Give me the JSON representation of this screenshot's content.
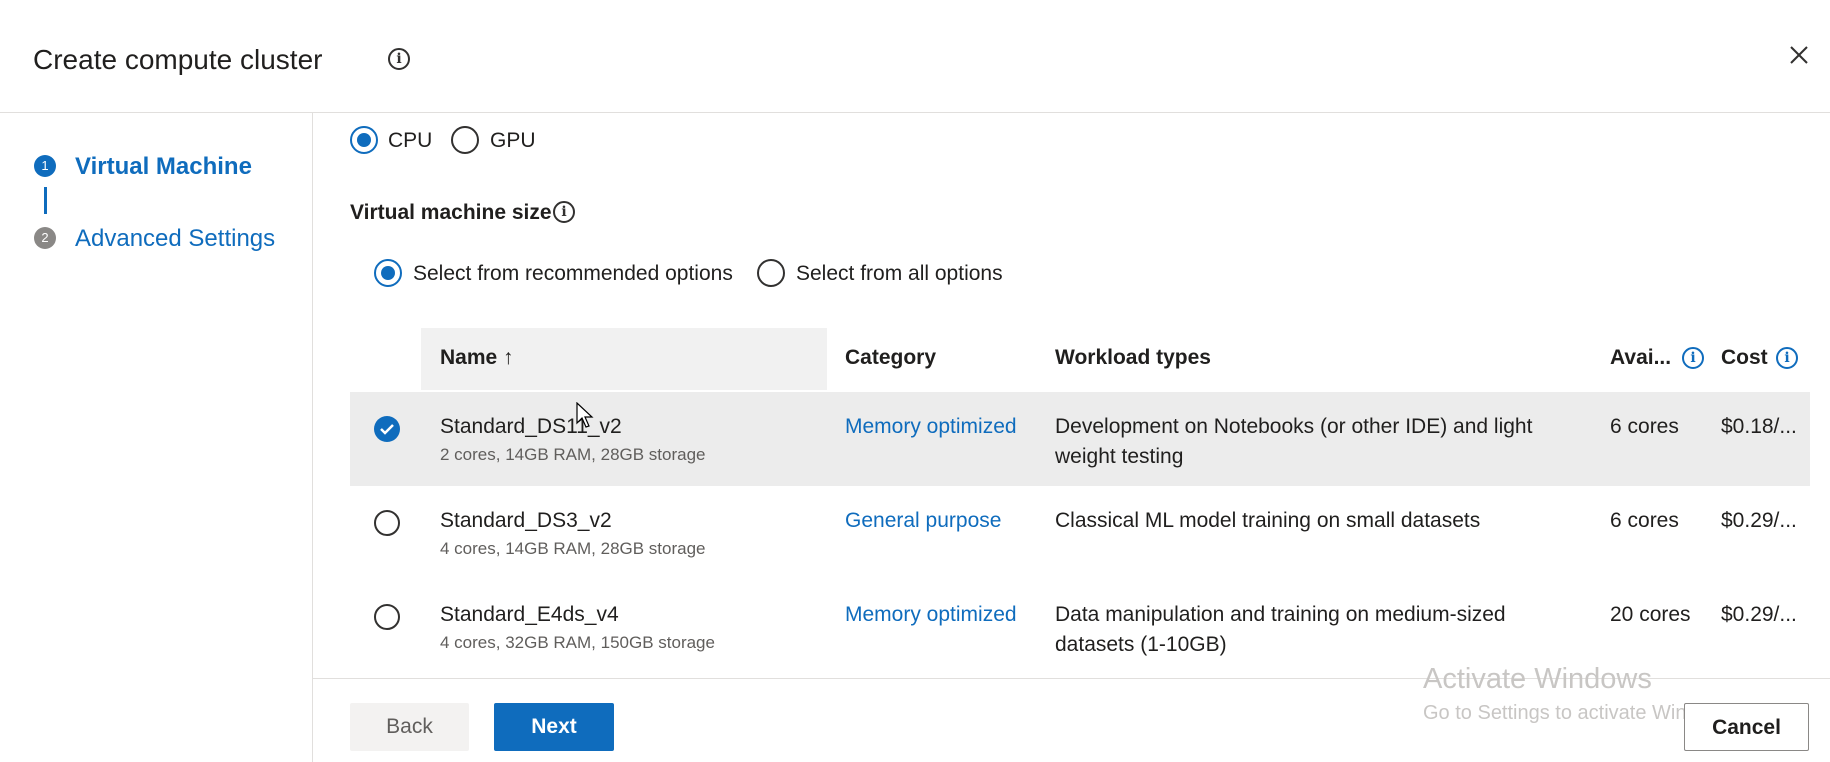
{
  "header": {
    "title": "Create compute cluster"
  },
  "stepper": {
    "steps": [
      {
        "number": "1",
        "label": "Virtual Machine"
      },
      {
        "number": "2",
        "label": "Advanced Settings"
      }
    ]
  },
  "processor": {
    "options": [
      {
        "label": "CPU",
        "checked": true
      },
      {
        "label": "GPU",
        "checked": false
      }
    ]
  },
  "vm_size": {
    "label": "Virtual machine size",
    "options": [
      {
        "label": "Select from recommended options",
        "checked": true
      },
      {
        "label": "Select from all options",
        "checked": false
      }
    ]
  },
  "table": {
    "columns": {
      "name": "Name ↑",
      "category": "Category",
      "workload": "Workload types",
      "available": "Avai...",
      "cost": "Cost"
    },
    "rows": [
      {
        "name": "Standard_DS11_v2",
        "specs": "2 cores, 14GB RAM, 28GB storage",
        "category": "Memory optimized",
        "workload_line1": "Development on Notebooks (or other IDE) and light",
        "workload_line2": "weight testing",
        "available": "6 cores",
        "cost": "$0.18/...",
        "selected": true
      },
      {
        "name": "Standard_DS3_v2",
        "specs": "4 cores, 14GB RAM, 28GB storage",
        "category": "General purpose",
        "workload_line1": "Classical ML model training on small datasets",
        "workload_line2": "",
        "available": "6 cores",
        "cost": "$0.29/...",
        "selected": false
      },
      {
        "name": "Standard_E4ds_v4",
        "specs": "4 cores, 32GB RAM, 150GB storage",
        "category": "Memory optimized",
        "workload_line1": "Data manipulation and training on medium-sized",
        "workload_line2": "datasets (1-10GB)",
        "available": "20 cores",
        "cost": "$0.29/...",
        "selected": false
      }
    ]
  },
  "footer": {
    "back": "Back",
    "next": "Next",
    "cancel": "Cancel"
  },
  "watermark": {
    "line1": "Activate Windows",
    "line2": "Go to Settings to activate Windows."
  },
  "colors": {
    "accent": "#0f6cbd",
    "selected_row": "#ececec"
  },
  "icons": [
    "info-icon",
    "close-icon",
    "pointer-cursor-icon"
  ]
}
